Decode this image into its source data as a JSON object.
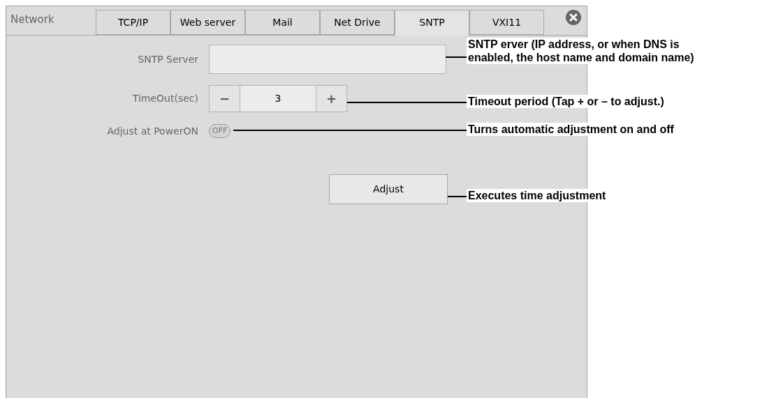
{
  "panel": {
    "title": "Network"
  },
  "tabs": [
    {
      "label": "TCP/IP",
      "selected": false
    },
    {
      "label": "Web server",
      "selected": false
    },
    {
      "label": "Mail",
      "selected": false
    },
    {
      "label": "Net Drive",
      "selected": false
    },
    {
      "label": "SNTP",
      "selected": true
    },
    {
      "label": "VXI11",
      "selected": false
    }
  ],
  "sntp_server": {
    "label": "SNTP Server"
  },
  "timeout": {
    "label": "TimeOut(sec)",
    "decrement": "−",
    "value": "3",
    "increment": "+"
  },
  "adjust_at_power_on": {
    "label": "Adjust at PowerON",
    "on": false,
    "text": "OFF"
  },
  "adjust_button": {
    "label": "Adjust"
  },
  "callouts": [
    {
      "lines": [
        "SNTP erver (IP address, or when DNS is",
        "enabled, the host name and domain name)"
      ]
    },
    {
      "lines": [
        "Timeout period (Tap + or – to adjust.)"
      ]
    },
    {
      "lines": [
        "Turns automatic adjustment on and off"
      ]
    },
    {
      "lines": [
        "Executes time adjustment"
      ]
    }
  ]
}
